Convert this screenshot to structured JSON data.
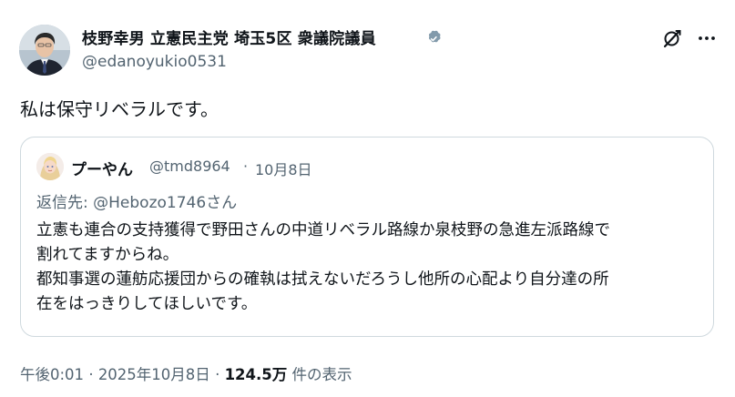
{
  "post": {
    "author": {
      "name": "枝野幸男 立憲民主党 埼玉5区 衆議院議員",
      "handle": "@edanoyukio0531",
      "verified": true
    },
    "text": "私は保守リベラルです。",
    "quoted": {
      "author_name": "プーやん",
      "handle": "@tmd8964",
      "separator": "·",
      "date": "10月8日",
      "reply_to": "返信先: @Hebozo1746さん",
      "lines": [
        "立憲も連合の支持獲得で野田さんの中道リベラル路線か泉枝野の急進左派路線で",
        "割れてますからね。",
        "都知事選の蓮舫応援団からの確執は拭えないだろうし他所の心配より自分達の所",
        "在をはっきりしてほしいです。"
      ]
    },
    "meta": {
      "time": "午後0:01",
      "separator": "·",
      "date": "2025年10月8日",
      "views_count": "124.5万",
      "views_label": "件の表示"
    }
  },
  "icons": {
    "verified": "verified-badge-icon",
    "grok": "grok-icon",
    "more": "more-options-icon"
  },
  "colors": {
    "primary_text": "#0f1419",
    "secondary_text": "#536471",
    "border": "#cfd9de",
    "verified_badge": "#829aab"
  }
}
